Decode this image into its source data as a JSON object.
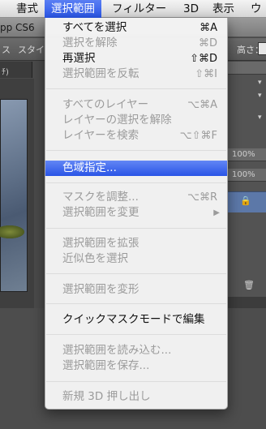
{
  "menubar": {
    "items": [
      {
        "label": "書式"
      },
      {
        "label": "選択範囲"
      },
      {
        "label": "フィルター"
      },
      {
        "label": "3D"
      },
      {
        "label": "表示"
      },
      {
        "label": "ウ"
      }
    ],
    "active_index": 1
  },
  "app": {
    "title_fragment": "pp CS6",
    "options": {
      "style_fragment": "スタイ",
      "height_label": "高さ：",
      "left_fragment": "ス"
    },
    "doc_tab_fragment": "ﾁ)",
    "panels": {
      "opacity_1": "100%",
      "opacity_2": "100%"
    }
  },
  "menu": {
    "groups": [
      [
        {
          "label": "すべてを選択",
          "shortcut": "⌘A",
          "enabled": true
        },
        {
          "label": "選択を解除",
          "shortcut": "⌘D",
          "enabled": false
        },
        {
          "label": "再選択",
          "shortcut": "⇧⌘D",
          "enabled": true
        },
        {
          "label": "選択範囲を反転",
          "shortcut": "⇧⌘I",
          "enabled": false
        }
      ],
      [
        {
          "label": "すべてのレイヤー",
          "shortcut": "⌥⌘A",
          "enabled": false
        },
        {
          "label": "レイヤーの選択を解除",
          "shortcut": "",
          "enabled": false
        },
        {
          "label": "レイヤーを検索",
          "shortcut": "⌥⇧⌘F",
          "enabled": false
        }
      ],
      [
        {
          "label": "色域指定...",
          "shortcut": "",
          "enabled": true,
          "highlighted": true
        }
      ],
      [
        {
          "label": "マスクを調整...",
          "shortcut": "⌥⌘R",
          "enabled": false
        },
        {
          "label": "選択範囲を変更",
          "shortcut": "",
          "enabled": false,
          "submenu": true
        }
      ],
      [
        {
          "label": "選択範囲を拡張",
          "shortcut": "",
          "enabled": false
        },
        {
          "label": "近似色を選択",
          "shortcut": "",
          "enabled": false
        }
      ],
      [
        {
          "label": "選択範囲を変形",
          "shortcut": "",
          "enabled": false
        }
      ],
      [
        {
          "label": "クイックマスクモードで編集",
          "shortcut": "",
          "enabled": true
        }
      ],
      [
        {
          "label": "選択範囲を読み込む...",
          "shortcut": "",
          "enabled": false
        },
        {
          "label": "選択範囲を保存...",
          "shortcut": "",
          "enabled": false
        }
      ],
      [
        {
          "label": "新規 3D 押し出し",
          "shortcut": "",
          "enabled": false
        }
      ]
    ]
  },
  "colors": {
    "highlight": "#2954e6",
    "disabled_text": "#9b9b9b",
    "menu_background": "#f4f4f4"
  }
}
